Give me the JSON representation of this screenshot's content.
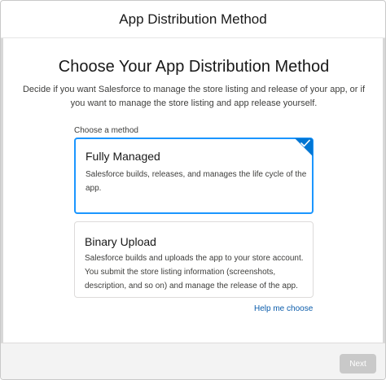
{
  "header": {
    "title": "App Distribution Method"
  },
  "main": {
    "title": "Choose Your App Distribution Method",
    "description": "Decide if you want Salesforce to manage the store listing and release of your app, or if you want to manage the store listing and app release yourself.",
    "method_label": "Choose a method",
    "options": [
      {
        "title": "Fully Managed",
        "description": "Salesforce builds, releases, and manages the life cycle of the app.",
        "selected": true
      },
      {
        "title": "Binary Upload",
        "description": "Salesforce builds and uploads the app to your store account. You submit the store listing information (screenshots, description, and so on) and manage the release of the app.",
        "selected": false
      }
    ],
    "help_link": "Help me choose"
  },
  "footer": {
    "next_label": "Next",
    "next_disabled": true
  },
  "colors": {
    "selected_border": "#1b96ff",
    "check_badge": "#0176d3",
    "link": "#0b5cab",
    "disabled_button": "#c9c9c9"
  },
  "icons": {
    "selected_check": "check-icon"
  }
}
